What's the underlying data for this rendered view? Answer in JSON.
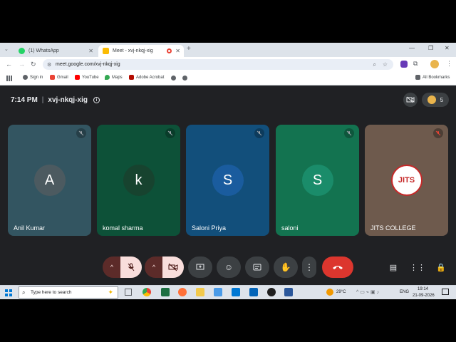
{
  "browser": {
    "tabs": [
      {
        "title": "(1) WhatsApp",
        "icon": "whatsapp-icon",
        "color": "#25d366"
      },
      {
        "title": "Meet - xvj-nkqj-xig",
        "icon": "meet-icon",
        "color": "#fbbc04"
      }
    ],
    "new_tab": "+",
    "url": "meet.google.com/xvj-nkqj-xig",
    "bookmarks": [
      {
        "label": "Sign in",
        "icon": "globe-icon",
        "color": "#5f6368"
      },
      {
        "label": "Gmail",
        "icon": "gmail-icon",
        "color": "#ea4335"
      },
      {
        "label": "YouTube",
        "icon": "youtube-icon",
        "color": "#ff0000"
      },
      {
        "label": "Maps",
        "icon": "maps-icon",
        "color": "#34a853"
      },
      {
        "label": "Adobe Acrobat",
        "icon": "acrobat-icon",
        "color": "#b30b00"
      }
    ],
    "all_bookmarks": "All Bookmarks"
  },
  "meeting": {
    "time": "7:14 PM",
    "code": "xvj-nkqj-xig",
    "participant_count": "5",
    "participants": [
      {
        "initial": "A",
        "name": "Anil Kumar",
        "bg": "#335561",
        "avatar_bg": "#4c5a60"
      },
      {
        "initial": "k",
        "name": "komal sharma",
        "bg": "#0d5138",
        "avatar_bg": "#17432f"
      },
      {
        "initial": "S",
        "name": "Saloni Priya",
        "bg": "#124f7b",
        "avatar_bg": "#1a5c9e"
      },
      {
        "initial": "S",
        "name": "saloni",
        "bg": "#137350",
        "avatar_bg": "#1a8c6a"
      },
      {
        "initial": "",
        "name": "JITS COLLEGE",
        "bg": "#6e5a4d",
        "avatar_bg": "#ffffff",
        "logo_text": "JITS"
      }
    ]
  },
  "colors": {
    "accent_red": "#ea4335",
    "muted_btn_bg": "#f9dedc",
    "end_call": "#dc362e"
  },
  "taskbar": {
    "search_placeholder": "Type here to search",
    "weather": "29°C",
    "language": "ENG",
    "time": "19:14",
    "date": "21-09-2026"
  }
}
